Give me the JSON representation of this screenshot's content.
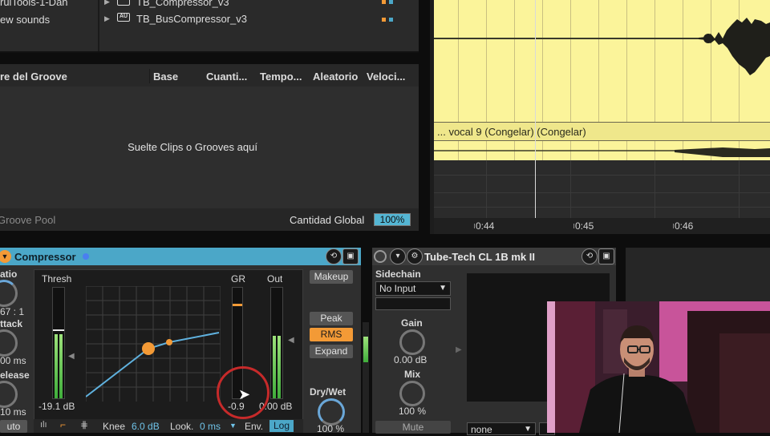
{
  "browser": {
    "left_items": [
      "ruiTools-1-Dan",
      "ew sounds"
    ],
    "plugins": [
      {
        "name": "TB_Compressor_v3",
        "tag": ""
      },
      {
        "name": "TB_BusCompressor_v3",
        "tag": "AU"
      }
    ]
  },
  "groove_pool": {
    "columns": [
      "re del Groove",
      "Base",
      "Cuanti...",
      "Tempo...",
      "Aleatorio",
      "Veloci..."
    ],
    "drop_hint": "Suelte Clips o Grooves aquí",
    "footer_title": "Groove Pool",
    "global_label": "Cantidad Global",
    "global_value": "100%"
  },
  "arrangement": {
    "clip_name": "... vocal 9 (Congelar) (Congelar)",
    "ruler": [
      "0:44",
      "0:45",
      "0:46"
    ],
    "clip_color": "#fbf49a"
  },
  "compressor": {
    "title": "Compressor",
    "ratio_label": "atio",
    "ratio_value": "67 : 1",
    "attack_label": "ttack",
    "attack_value": "00 ms",
    "release_label": "elease",
    "release_value": "10 ms",
    "auto_label": "uto",
    "thresh_label": "Thresh",
    "thresh_value": "-19.1 dB",
    "gr_label": "GR",
    "gr_value": "-0.9",
    "out_label": "Out",
    "out_value": "0.00 dB",
    "makeup": "Makeup",
    "modes": [
      "Peak",
      "RMS",
      "Expand"
    ],
    "active_mode": "RMS",
    "drywet_label": "Dry/Wet",
    "drywet_value": "100 %",
    "knee_label": "Knee",
    "knee_value": "6.0 dB",
    "look_label": "Look.",
    "look_value": "0 ms",
    "env_label": "Env.",
    "env_value": "Log",
    "title_color": "#4ba7c8",
    "active_color": "#f39a36"
  },
  "tubetech": {
    "title": "Tube-Tech CL 1B mk II",
    "sidechain_label": "Sidechain",
    "sidechain_value": "No Input",
    "gain_label": "Gain",
    "gain_value": "0.00 dB",
    "mix_label": "Mix",
    "mix_value": "100 %",
    "mute": "Mute",
    "bottom_select": "none"
  }
}
